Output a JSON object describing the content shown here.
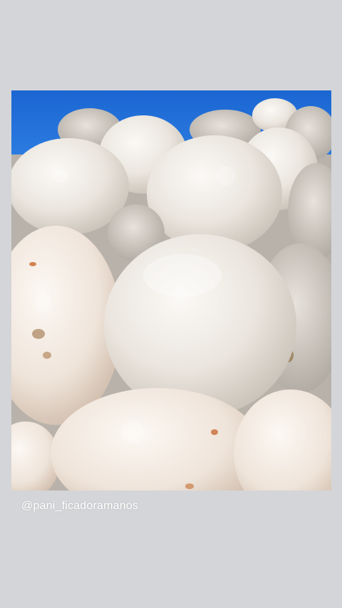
{
  "story": {
    "background_color": "#d4d5d8",
    "photo": {
      "subject": "pão de queijo (cheese bread rolls)",
      "dominant_colors": [
        "#1f6fd6",
        "#e9e4dd",
        "#f2eee8",
        "#c9a78a"
      ]
    },
    "caption": {
      "text": "@pani_ficadoramanos",
      "color": "#ffffff"
    }
  }
}
